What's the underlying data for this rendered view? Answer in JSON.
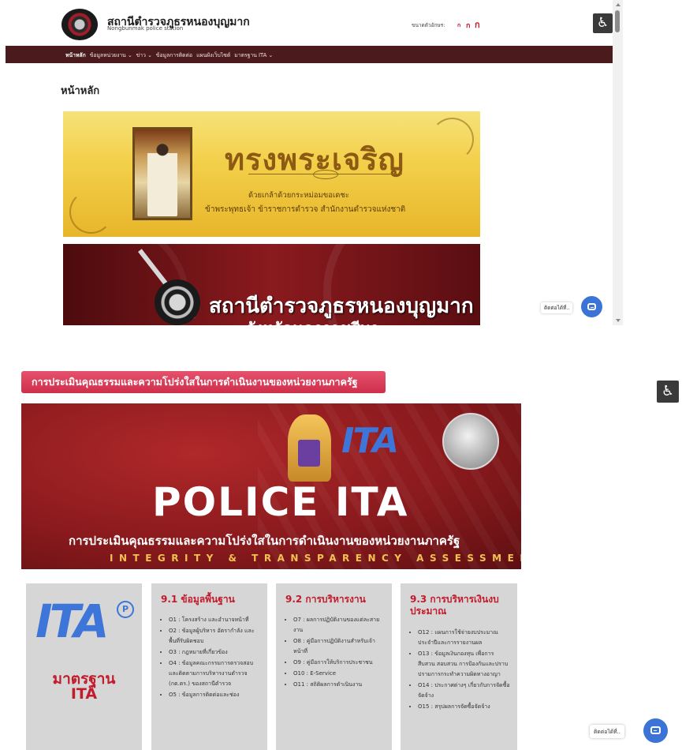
{
  "header": {
    "site_title": "สถานีตำรวจภูธรหนองบุญมาก",
    "site_subtitle": "Nongbunmak police station",
    "font_size_label": "ขนาดตัวอักษร:",
    "font_sizes": [
      "ก",
      "ก",
      "ก"
    ],
    "accessibility_icon": "wheelchair-icon"
  },
  "nav": {
    "items": [
      {
        "label": "หน้าหลัก"
      },
      {
        "label": "ข้อมูลหน่วยงาน ⌄"
      },
      {
        "label": "ข่าว ⌄"
      },
      {
        "label": "ข้อมูลการติดต่อ"
      },
      {
        "label": "แผนผังเว็บไซต์"
      },
      {
        "label": "มาตรฐาน ITA ⌄"
      }
    ]
  },
  "main": {
    "heading": "หน้าหลัก",
    "banner1": {
      "title": "ทรงพระเจริญ",
      "line1": "ด้วยเกล้าด้วยกระหม่อมขอเดชะ",
      "line2": "ข้าพระพุทธเจ้า ข้าราชการตำรวจ สำนักงานตำรวจแห่งชาติ"
    },
    "banner2": {
      "name": "สถานีตำรวจภูธรหนองบุญมาก",
      "sub": "จังหวัดนครราชสีมา"
    }
  },
  "contact": {
    "label": "ติดต่อได้ที่..",
    "icon": "chat-icon",
    "color": "#3b74d6"
  },
  "ita": {
    "heading": "การประเมินคุณธรรมและความโปร่งใสในการดำเนินงานของหน่วยงานภาครัฐ",
    "banner": {
      "logo_text": "ITA",
      "big_text": "POLICE ITA",
      "thai_text": "การประเมินคุณธรรมและความโปร่งใสในการดำเนินงานของหน่วยงานภาครัฐ",
      "eng_text": "INTEGRITY & TRANSPARENCY ASSESSMENT"
    },
    "standard": {
      "logo_text": "ITA",
      "logo_mark": "P",
      "line1": "มาตรฐาน",
      "line2": "ITA"
    },
    "sections": [
      {
        "title": "9.1 ข้อมูลพื้นฐาน",
        "items": [
          "O1 : โครงสร้าง และอำนาจหน้าที่",
          "O2 : ข้อมูลผู้บริหาร อัตรากำลัง และพื้นที่รับผิดชอบ",
          "O3 : กฎหมายที่เกี่ยวข้อง",
          "O4 : ข้อมูลคณะกรรมการตรวจสอบและติดตามการบริหารงานตำรวจ (กต.ตร.) ของสถานีตำรวจ",
          "O5 : ข้อมูลการติดต่อและช่อง"
        ]
      },
      {
        "title": "9.2 การบริหารงาน",
        "items": [
          "O7 : ผลการปฏิบัติงานของแต่ละสายงาน",
          "O8 : คู่มือการปฏิบัติงานสำหรับเจ้าหน้าที่",
          "O9 : คู่มือการให้บริการประชาชน",
          "O10 : E-Service",
          "O11 : สถิติผลการดำเนินงาน"
        ]
      },
      {
        "title": "9.3 การบริหารเงินงบประมาณ",
        "items": [
          "O12 : แผนการใช้จ่ายงบประมาณประจำปีและการรายงานผล",
          "O13 : ข้อมูลเงินกองทุน เพื่อการสืบสวน สอบสวน การป้องกันและปราบปรามการกระทำความผิดทางอาญา",
          "O14 : ประกาศต่างๆ เกี่ยวกับการจัดซื้อจัดจ้าง",
          "O15 : สรุปผลการจัดซื้อจัดจ้าง"
        ]
      }
    ]
  }
}
